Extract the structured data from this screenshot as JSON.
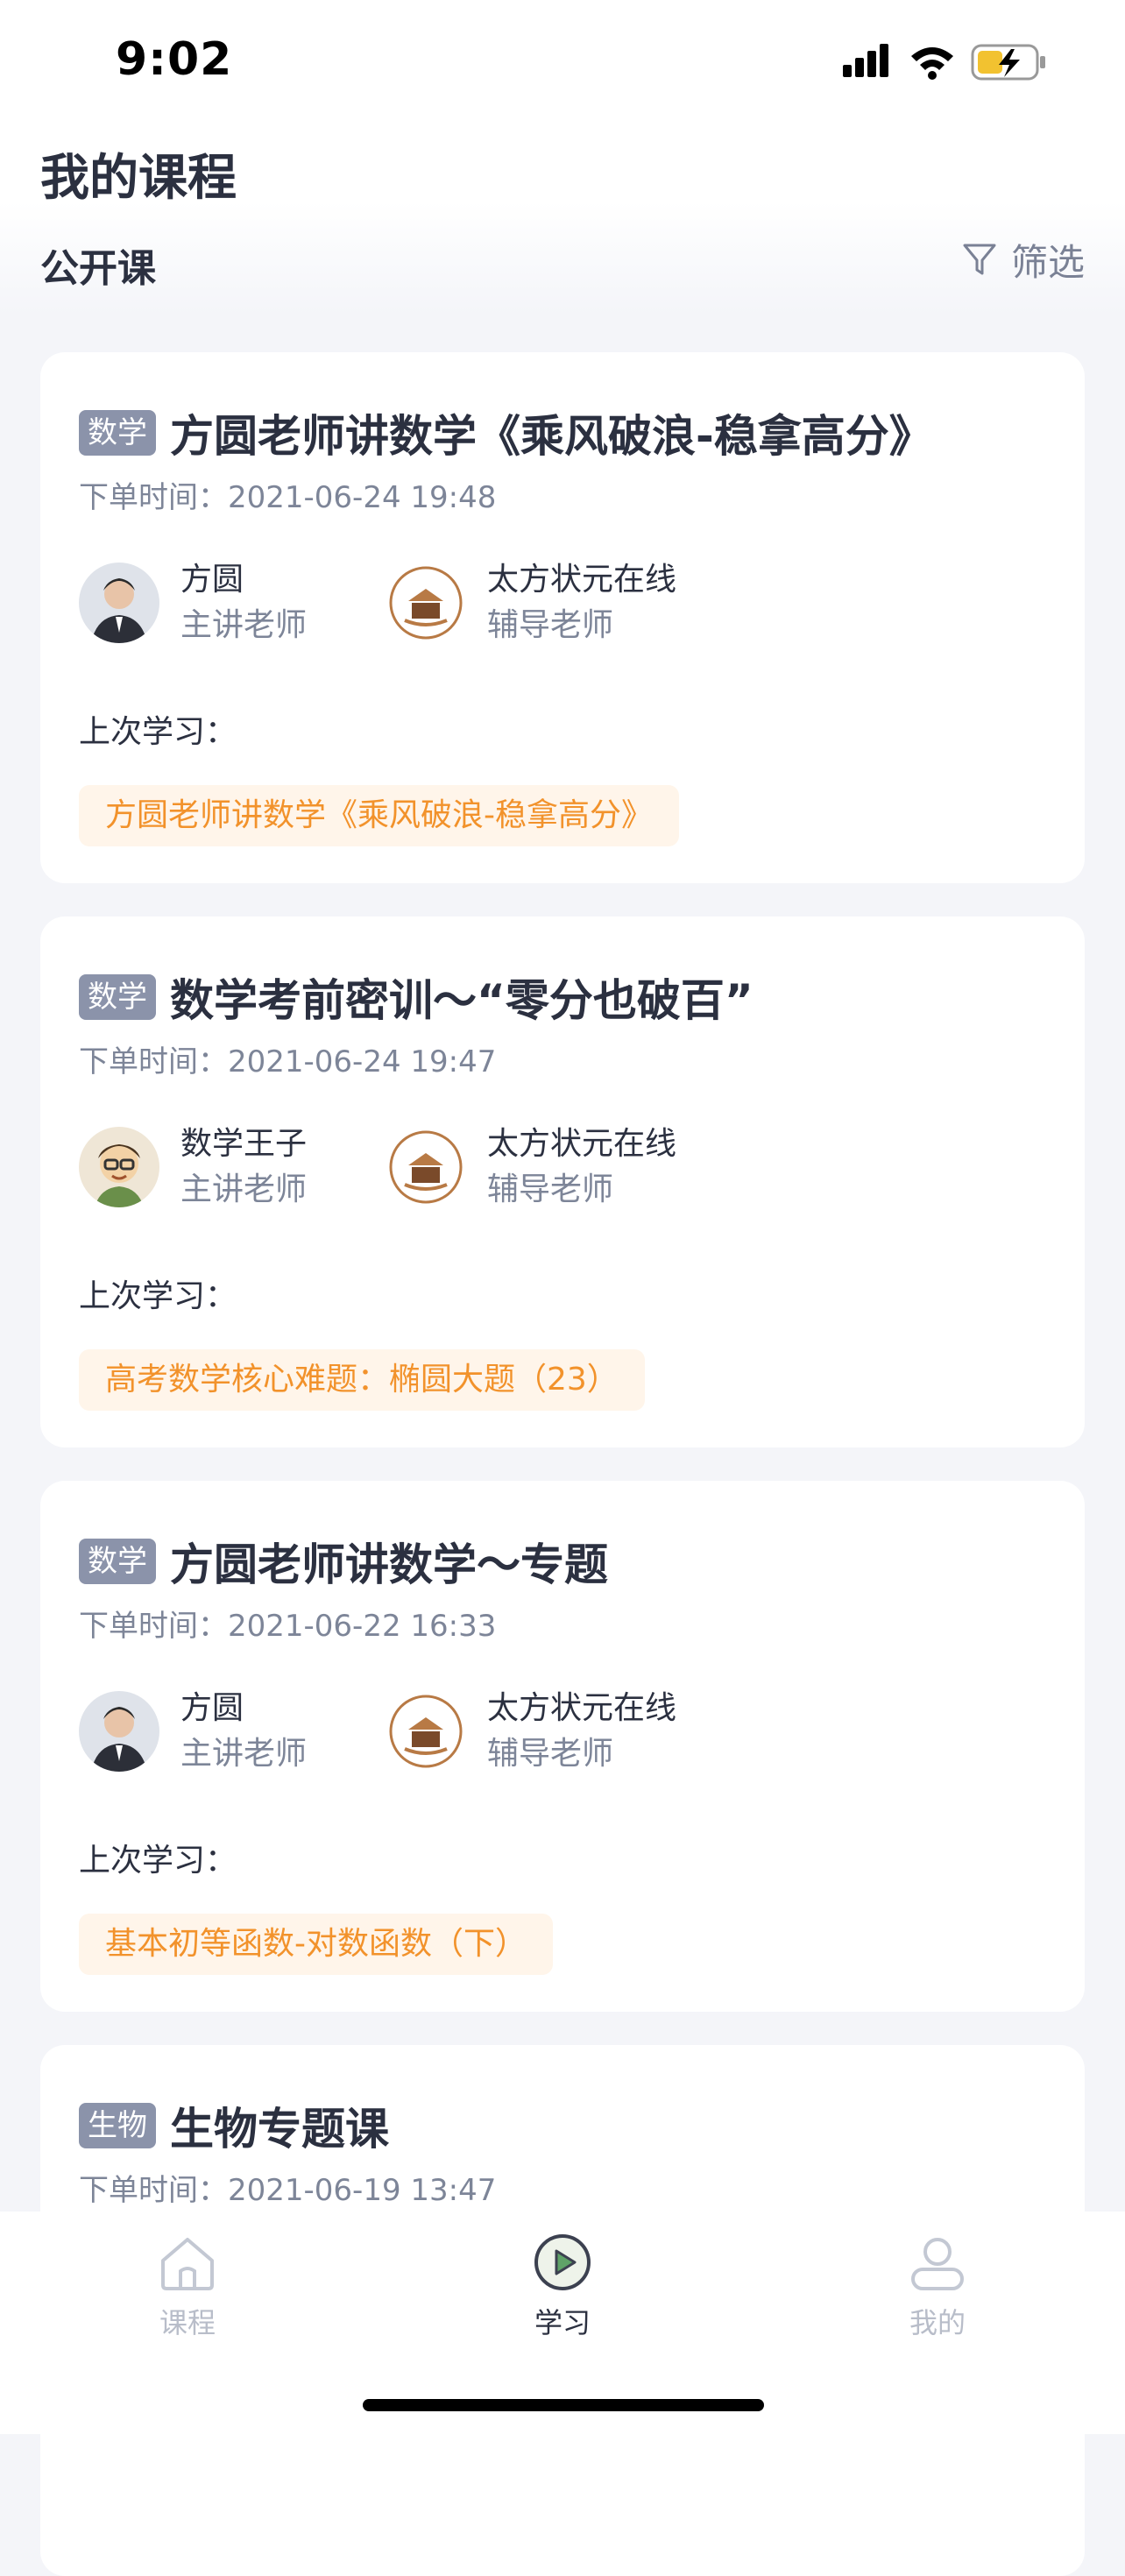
{
  "status_bar": {
    "time": "9:02"
  },
  "header": {
    "title": "我的课程",
    "section": "公开课",
    "filter_label": "筛选"
  },
  "time_prefix": "下单时间：",
  "last_study_label": "上次学习：",
  "cards": [
    {
      "subject": "数学",
      "title": "方圆老师讲数学《乘风破浪-稳拿高分》",
      "order_time": "2021-06-24 19:48",
      "teacher_main": {
        "name": "方圆",
        "role": "主讲老师"
      },
      "teacher_tutor": {
        "name": "太方状元在线",
        "role": "辅导老师"
      },
      "last_study": "方圆老师讲数学《乘风破浪-稳拿高分》"
    },
    {
      "subject": "数学",
      "title": "数学考前密训～“零分也破百”",
      "order_time": "2021-06-24 19:47",
      "teacher_main": {
        "name": "数学王子",
        "role": "主讲老师"
      },
      "teacher_tutor": {
        "name": "太方状元在线",
        "role": "辅导老师"
      },
      "last_study": "高考数学核心难题：椭圆大题（23）"
    },
    {
      "subject": "数学",
      "title": "方圆老师讲数学～专题",
      "order_time": "2021-06-22 16:33",
      "teacher_main": {
        "name": "方圆",
        "role": "主讲老师"
      },
      "teacher_tutor": {
        "name": "太方状元在线",
        "role": "辅导老师"
      },
      "last_study": "基本初等函数-对数函数（下）"
    },
    {
      "subject": "生物",
      "title": "生物专题课",
      "order_time": "2021-06-19 13:47"
    }
  ],
  "tab_bar": {
    "tabs": [
      {
        "label": "课程",
        "icon": "home-icon"
      },
      {
        "label": "学习",
        "icon": "play-circle-icon",
        "active": true
      },
      {
        "label": "我的",
        "icon": "profile-icon"
      }
    ]
  },
  "colors": {
    "accent_orange": "#f2922b",
    "chip_bg": "#fff5ea",
    "tag_bg": "#8b93aa",
    "text_dark": "#2b3040",
    "text_gray": "#7d8598",
    "active_green": "#5fa368"
  }
}
